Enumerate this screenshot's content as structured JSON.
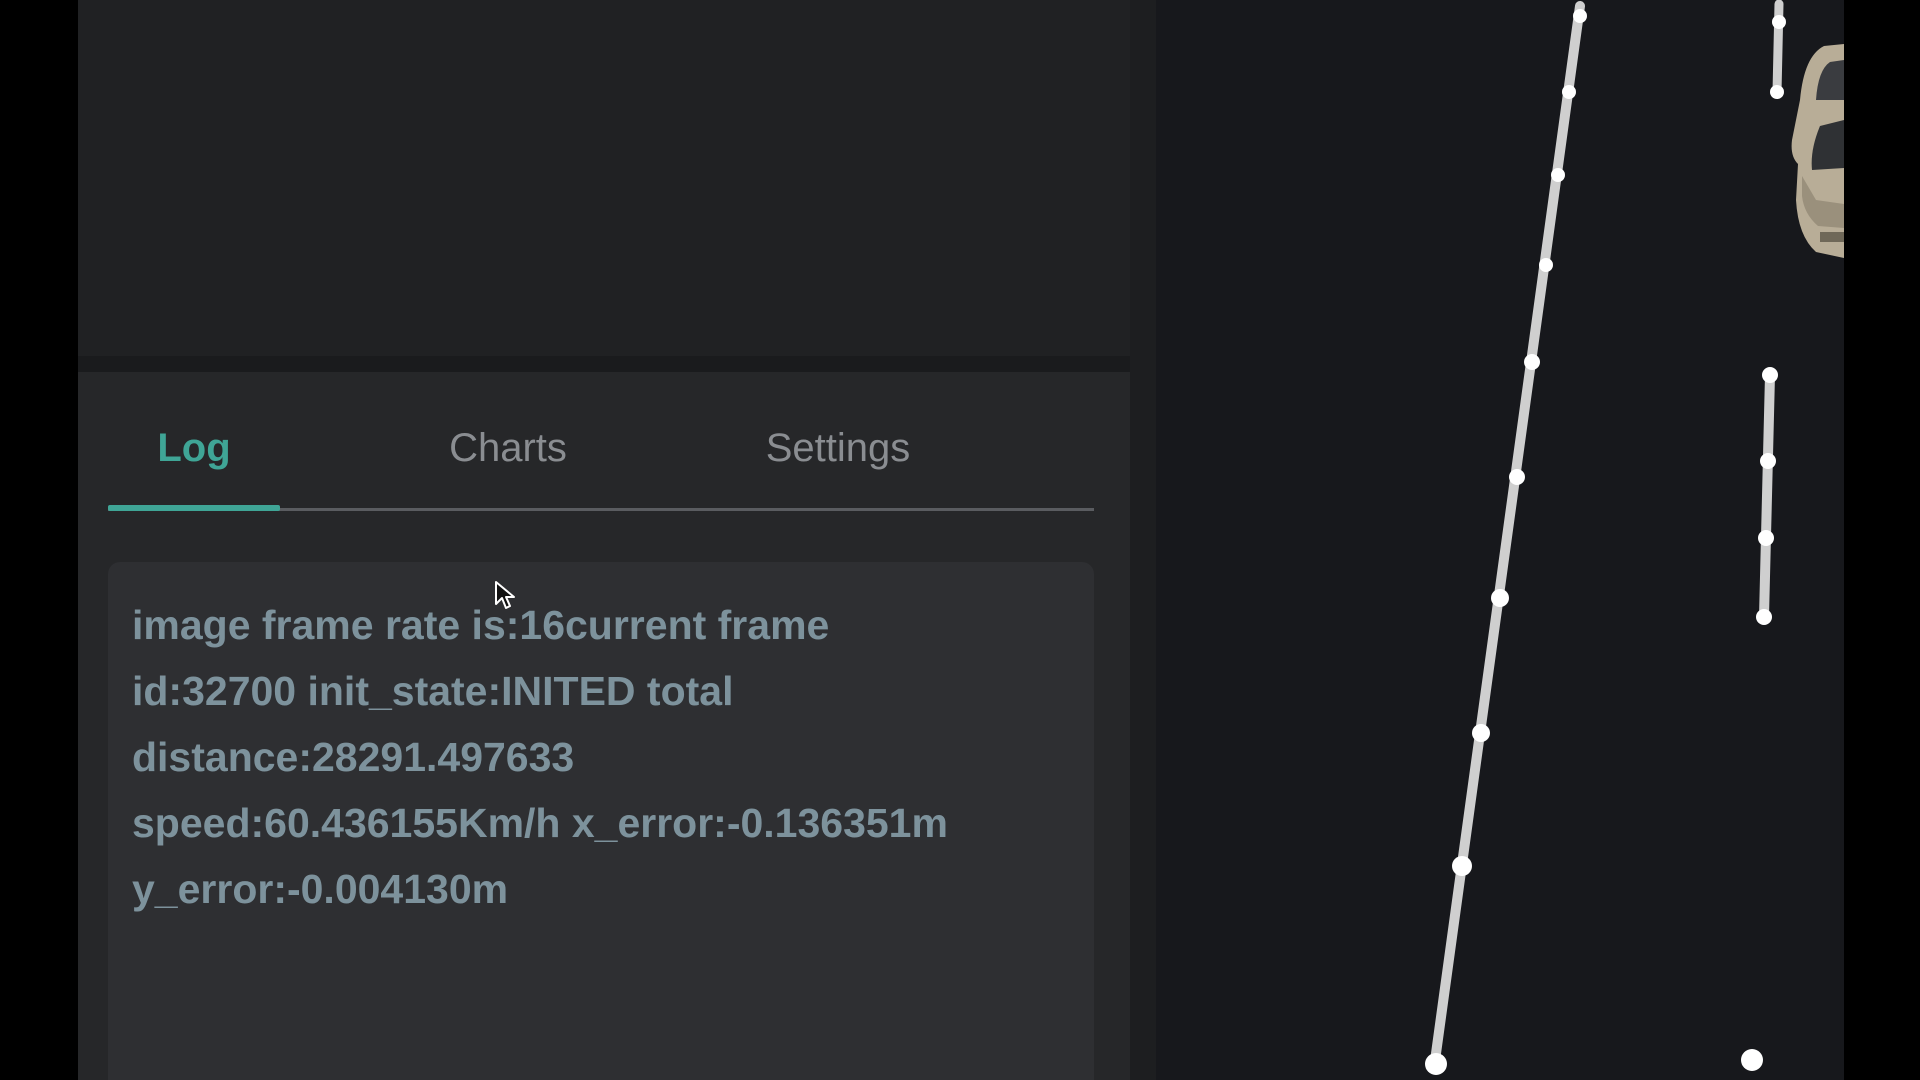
{
  "tabs": {
    "items": [
      {
        "label": "Log",
        "active": true
      },
      {
        "label": "Charts",
        "active": false
      },
      {
        "label": "Settings",
        "active": false
      }
    ],
    "accent_color": "#3fa596"
  },
  "log": {
    "lines": [
      "image frame rate is:16current frame",
      "id:32700 init_state:INITED total",
      "distance:28291.497633",
      "speed:60.436155Km/h x_error:-0.136351m",
      "y_error:-0.004130m"
    ]
  },
  "map": {
    "lane_color": "#d8d8d8",
    "background": "#17181c",
    "vehicle": "car-icon"
  }
}
